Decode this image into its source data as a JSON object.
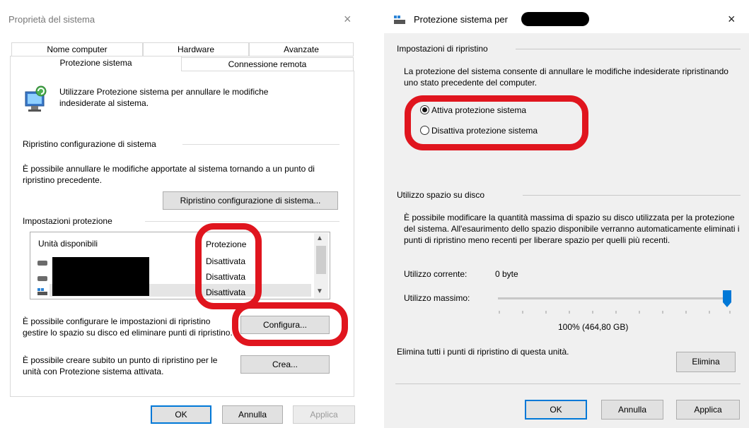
{
  "left": {
    "title": "Proprietà del sistema",
    "tabs_top": [
      "Nome computer",
      "Hardware",
      "Avanzate"
    ],
    "tabs_bottom": [
      "Protezione sistema",
      "Connessione remota"
    ],
    "intro": "Utilizzare Protezione sistema per annullare le modifiche indesiderate al sistema.",
    "restore_section": "Ripristino configurazione di sistema",
    "restore_desc": "È possibile annullare le modifiche apportate al sistema tornando a un punto di ripristino precedente.",
    "restore_button": "Ripristino configurazione di sistema...",
    "protection_section": "Impostazioni protezione",
    "drives_header": "Unità disponibili",
    "protection_header": "Protezione",
    "drives": [
      {
        "status": "Disattivata"
      },
      {
        "status": "Disattivata"
      },
      {
        "status": "Disattivata"
      }
    ],
    "configure_desc": "È possibile configurare le impostazioni di ripristino gestire lo spazio su disco ed eliminare punti di ripristino.",
    "configure_button": "Configura...",
    "create_desc": "È possibile creare subito un punto di ripristino per le unità con Protezione sistema attivata.",
    "create_button": "Crea...",
    "ok": "OK",
    "cancel": "Annulla",
    "apply": "Applica"
  },
  "right": {
    "title": "Protezione sistema per",
    "restore_settings": "Impostazioni di ripristino",
    "restore_desc": "La protezione del sistema consente di annullare le modifiche indesiderate ripristinando uno stato precedente del computer.",
    "radio_on": "Attiva protezione sistema",
    "radio_off": "Disattiva protezione sistema",
    "disk_section": "Utilizzo spazio su disco",
    "disk_desc": "È possibile modificare la quantità massima di spazio su disco utilizzata per la protezione del sistema. All'esaurimento dello spazio disponibile verranno automaticamente eliminati i punti di ripristino meno recenti per liberare spazio per quelli più recenti.",
    "current_label": "Utilizzo corrente:",
    "current_value": "0 byte",
    "max_label": "Utilizzo massimo:",
    "max_value": "100% (464,80 GB)",
    "slider_fraction": 1.0,
    "delete_desc": "Elimina tutti i punti di ripristino di questa unità.",
    "delete_button": "Elimina",
    "ok": "OK",
    "cancel": "Annulla",
    "apply": "Applica"
  },
  "colors": {
    "highlight": "#e0151e",
    "accent": "#0078d7"
  }
}
